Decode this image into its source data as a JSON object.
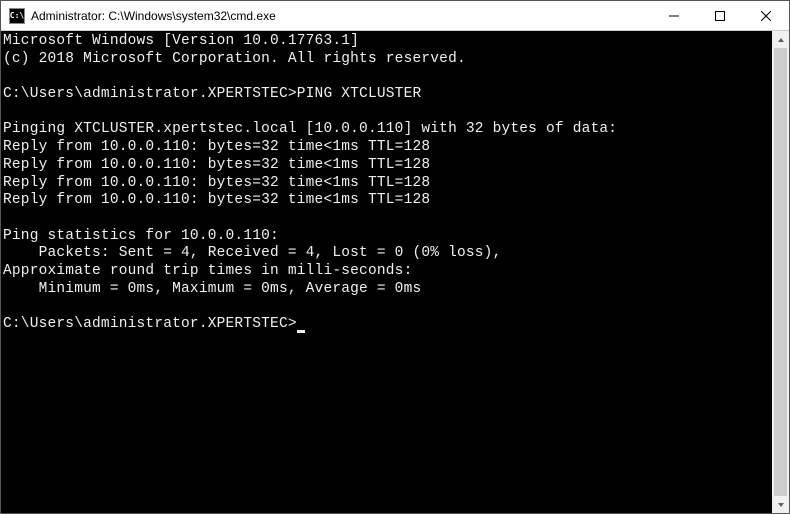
{
  "window": {
    "icon_text": "C:\\",
    "title": "Administrator: C:\\Windows\\system32\\cmd.exe"
  },
  "terminal": {
    "header_line1": "Microsoft Windows [Version 10.0.17763.1]",
    "header_line2": "(c) 2018 Microsoft Corporation. All rights reserved.",
    "prompt1_path": "C:\\Users\\administrator.XPERTSTEC>",
    "prompt1_cmd": "PING XTCLUSTER",
    "ping_header": "Pinging XTCLUSTER.xpertstec.local [10.0.0.110] with 32 bytes of data:",
    "replies": [
      "Reply from 10.0.0.110: bytes=32 time<1ms TTL=128",
      "Reply from 10.0.0.110: bytes=32 time<1ms TTL=128",
      "Reply from 10.0.0.110: bytes=32 time<1ms TTL=128",
      "Reply from 10.0.0.110: bytes=32 time<1ms TTL=128"
    ],
    "stats_header": "Ping statistics for 10.0.0.110:",
    "stats_packets": "    Packets: Sent = 4, Received = 4, Lost = 0 (0% loss),",
    "stats_rtt_header": "Approximate round trip times in milli-seconds:",
    "stats_rtt": "    Minimum = 0ms, Maximum = 0ms, Average = 0ms",
    "prompt2_path": "C:\\Users\\administrator.XPERTSTEC>"
  }
}
